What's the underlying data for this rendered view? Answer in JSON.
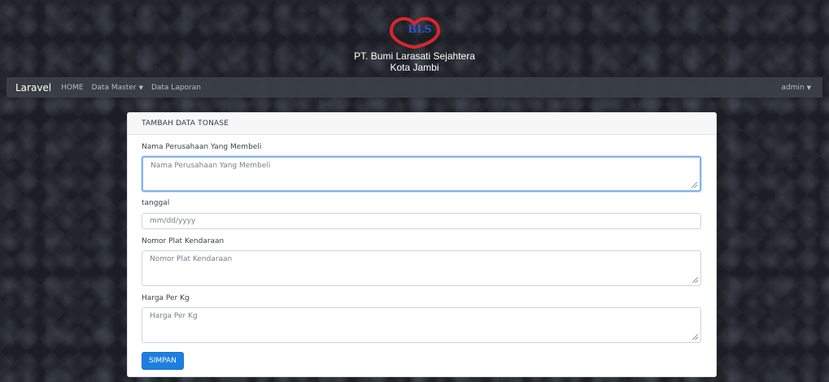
{
  "banner": {
    "logo_text": "BLS",
    "company": "PT. Bumi Larasati Sejahtera",
    "city": "Kota Jambi"
  },
  "navbar": {
    "brand": "Laravel",
    "items": [
      {
        "label": "HOME"
      },
      {
        "label": "Data Master",
        "dropdown": true
      },
      {
        "label": "Data Laporan"
      }
    ],
    "user": "admin"
  },
  "form": {
    "title": "TAMBAH DATA TONASE",
    "fields": [
      {
        "label": "Nama Perusahaan Yang Membeli",
        "placeholder": "Nama Perusahaan Yang Membeli",
        "type": "textarea"
      },
      {
        "label": "tanggal",
        "placeholder": "mm/dd/yyyy",
        "type": "date"
      },
      {
        "label": "Nomor Plat Kendaraan",
        "placeholder": "Nomor Plat Kendaraan",
        "type": "textarea"
      },
      {
        "label": "Harga Per Kg",
        "placeholder": "Harga Per Kg",
        "type": "textarea"
      }
    ],
    "submit": "SIMPAN"
  },
  "colors": {
    "accent": "#1e7fe0",
    "logo_red": "#d8262f",
    "logo_blue": "#2d55c8",
    "navbar": "#3c4048"
  },
  "icons": {
    "caret": "caret-down-icon"
  }
}
